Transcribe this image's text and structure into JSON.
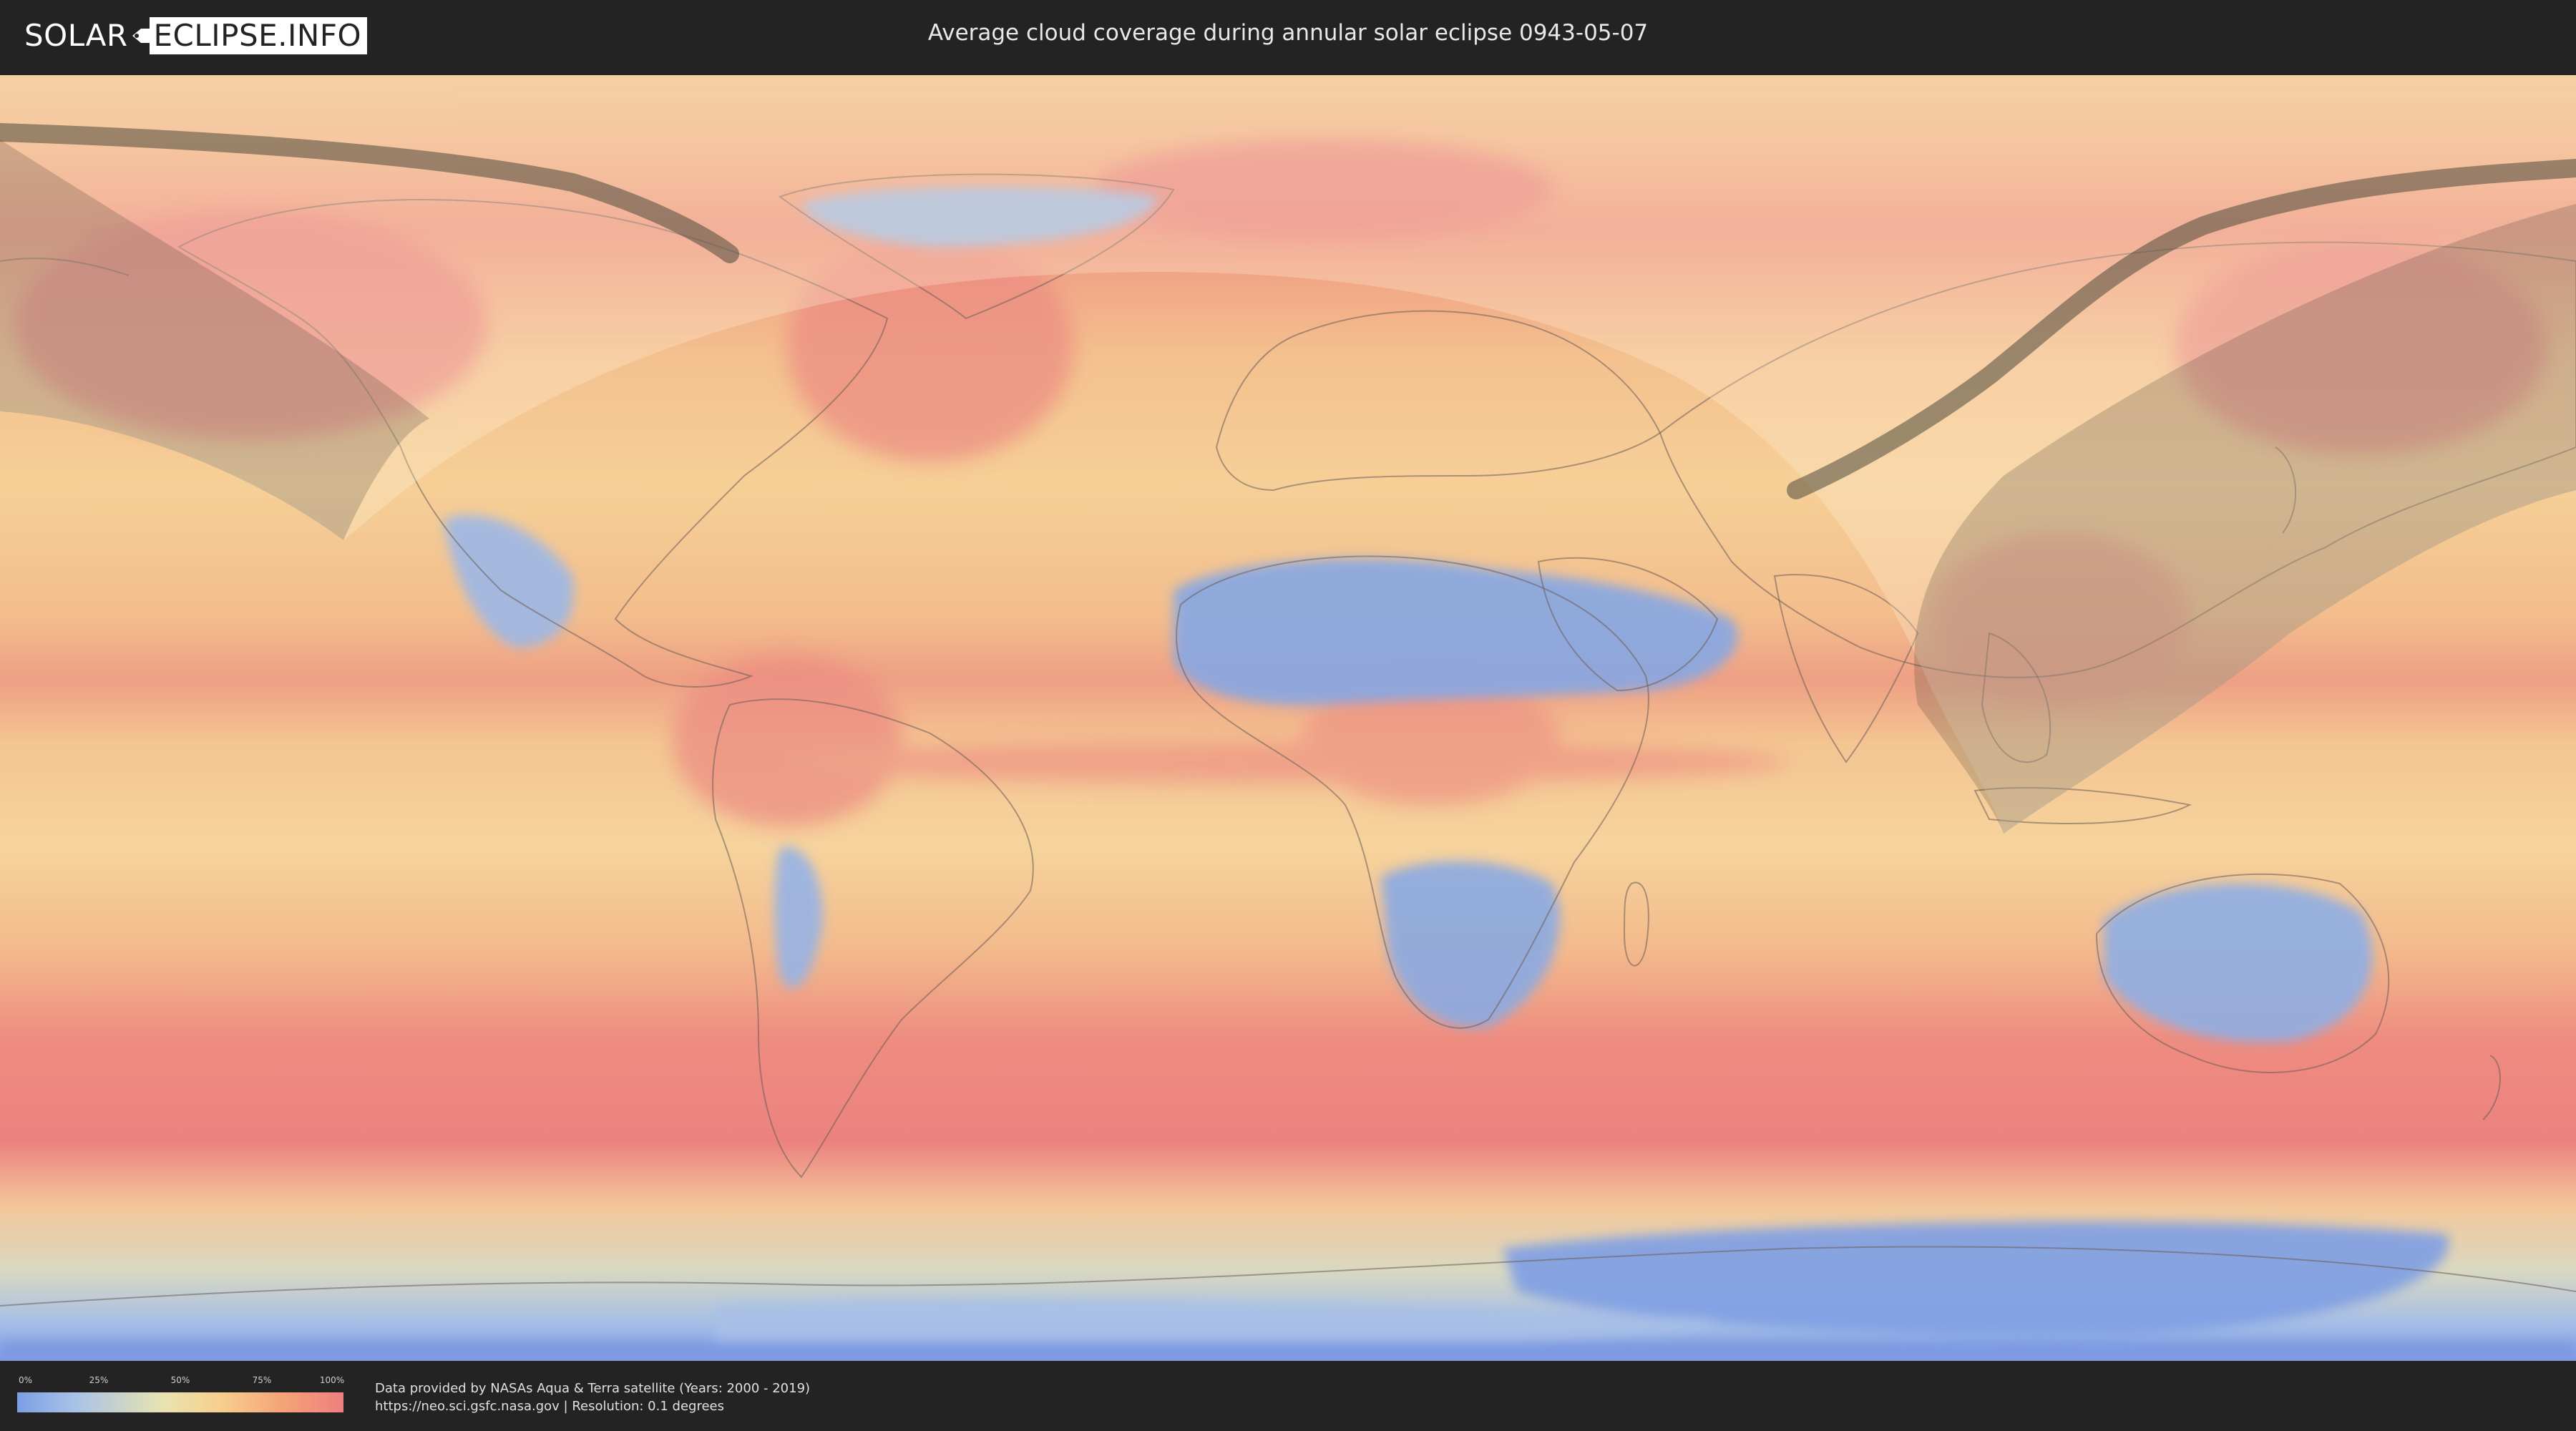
{
  "header": {
    "logo_part1": "SOLAR",
    "logo_part2": "ECLIPSE.INFO",
    "title": "Average cloud coverage during annular solar eclipse 0943-05-07"
  },
  "legend": {
    "ticks": [
      "0%",
      "25%",
      "50%",
      "75%",
      "100%"
    ],
    "colors": [
      "#7b9ee3",
      "#a9c3e7",
      "#e9e3b0",
      "#f7cf8e",
      "#f4a277",
      "#ee7f80"
    ]
  },
  "footer": {
    "credit_line1": "Data provided by NASAs Aqua & Terra satellite (Years: 2000 - 2019)",
    "credit_line2": "https://neo.sci.gsfc.nasa.gov | Resolution: 0.1 degrees"
  },
  "map": {
    "projection": "equirectangular",
    "layers": [
      "cloud-coverage",
      "country-borders",
      "eclipse-visibility-zone",
      "annularity-path"
    ],
    "colors": {
      "clear": "#7ea3e6",
      "low": "#a9c6ec",
      "mid": "#f2dba5",
      "high": "#f6b489",
      "overcast": "#ec8583",
      "path": "#5a5a4a",
      "visibility_zone": "#fff6dc"
    }
  }
}
